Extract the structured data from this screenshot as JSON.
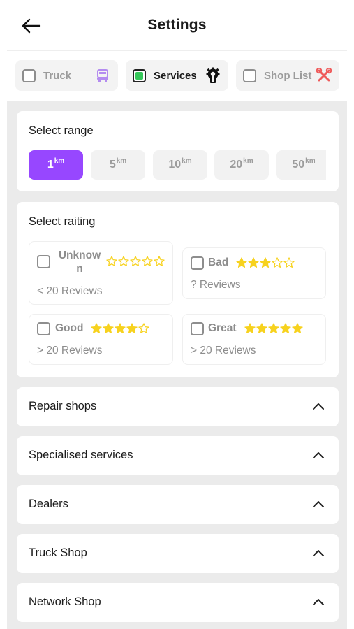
{
  "header": {
    "title": "Settings",
    "back_icon": "arrow-left-icon"
  },
  "tabs": [
    {
      "label": "Truck",
      "checked": false,
      "icon": "truck-icon",
      "icon_color": "#b48cf0"
    },
    {
      "label": "Services",
      "checked": true,
      "icon": "wrench-gear-icon",
      "icon_color": "#111111"
    },
    {
      "label": "Shop List",
      "checked": false,
      "icon": "crossed-tools-icon",
      "icon_color": "#ef5a5a"
    }
  ],
  "range": {
    "title": "Select range",
    "unit": "km",
    "options": [
      "1",
      "5",
      "10",
      "20",
      "50"
    ],
    "selected": "1"
  },
  "rating": {
    "title": "Select raiting",
    "options": [
      {
        "name": "Unknow n",
        "line1": "Unknow",
        "line2": "n",
        "stars": 0,
        "reviews": "< 20 Reviews"
      },
      {
        "name": "Bad",
        "stars": 3,
        "reviews": "? Reviews"
      },
      {
        "name": "Good",
        "stars": 4,
        "reviews": "> 20 Reviews"
      },
      {
        "name": "Great",
        "stars": 5,
        "reviews": "> 20 Reviews"
      }
    ]
  },
  "sections": [
    "Repair shops",
    "Specialised services",
    "Dealers",
    "Truck Shop",
    "Network Shop"
  ],
  "colors": {
    "accent": "#9747ff",
    "check_green": "#35c75a",
    "star_yellow": "#f7d21e",
    "background_gray": "#ebebeb"
  }
}
